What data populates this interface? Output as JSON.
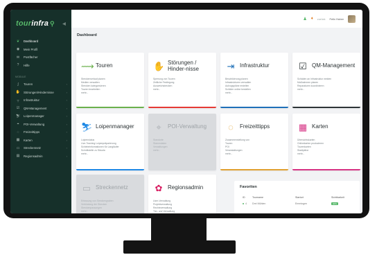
{
  "brand": {
    "part1": "tour",
    "part2": "infra",
    "pin_icon": "map-pin-icon"
  },
  "sidebar": {
    "items_top": [
      {
        "label": "Dashboard",
        "icon": "leaf-icon",
        "glyph": "❦",
        "active": true
      },
      {
        "label": "Mein Profil",
        "icon": "user-icon",
        "glyph": "◉",
        "active": false
      },
      {
        "label": "Postfächer",
        "icon": "mail-icon",
        "glyph": "✉",
        "active": false
      },
      {
        "label": "Hilfe",
        "icon": "help-icon",
        "glyph": "?",
        "active": false
      }
    ],
    "section_label": "MODULE",
    "items_modules": [
      {
        "label": "Touren",
        "icon": "route-icon",
        "glyph": "∫"
      },
      {
        "label": "Störungen/Hindernisse",
        "icon": "hand-icon",
        "glyph": "✋"
      },
      {
        "label": "Infrastruktur",
        "icon": "signpost-icon",
        "glyph": "┬"
      },
      {
        "label": "QM-Management",
        "icon": "checklist-icon",
        "glyph": "☑"
      },
      {
        "label": "Loipenmanager",
        "icon": "skier-icon",
        "glyph": "⛷"
      },
      {
        "label": "POI-Verwaltung",
        "icon": "poi-icon",
        "glyph": "⌖"
      },
      {
        "label": "Freizeittipps",
        "icon": "tips-icon",
        "glyph": "◌"
      },
      {
        "label": "Karten",
        "icon": "map-icon",
        "glyph": "▦"
      },
      {
        "label": "Streckennetz",
        "icon": "network-icon",
        "glyph": "▭"
      },
      {
        "label": "Regionsadmin",
        "icon": "admin-icon",
        "glyph": "▤"
      }
    ]
  },
  "topbar": {
    "link": "zurück",
    "user": "Felix Huber"
  },
  "page_title": "Dashboard",
  "cards": [
    {
      "title": "Touren",
      "icon": "route-icon",
      "glyph": "⟿",
      "color": "#6ab04c",
      "disabled": false,
      "lines": [
        "Streckenverlauf planen",
        "Medien verwalten",
        "Strecken kategorisieren",
        "Touren bearbeiten",
        "mehr..."
      ]
    },
    {
      "title": "Störungen / Hinder-nisse",
      "icon": "hand-stop-icon",
      "glyph": "✋",
      "color": "#e53935",
      "disabled": false,
      "lines": [
        "Sperrung von Touren",
        "Zeitliche Festlegung",
        "Ausweichstrecken",
        "mehr..."
      ]
    },
    {
      "title": "Infrastruktur",
      "icon": "signpost-icon",
      "glyph": "⇥",
      "color": "#1e6fb8",
      "disabled": false,
      "lines": [
        "Beschilderung planen",
        "Infrastrukturen verwalten",
        "Aufzugspläne erstellen",
        "Schilder online bestellen",
        "mehr..."
      ]
    },
    {
      "title": "QM-Management",
      "icon": "checklist-icon",
      "glyph": "☑",
      "color": "#2d3436",
      "disabled": false,
      "lines": [
        "Schäden an Infrastruktur melden",
        "Maßnahmen planen",
        "Reparaturen koordinieren",
        "mehr..."
      ]
    },
    {
      "title": "Loipenmanager",
      "icon": "skier-icon",
      "glyph": "⛷",
      "color": "#1e88e5",
      "disabled": false,
      "lines": [
        "Loipenstatus",
        "Live-Tracking Loipenpräparierung",
        "Schiebeinformationen für Langläufer",
        "Schnittstelle zu Skiuzla",
        "mehr..."
      ]
    },
    {
      "title": "POI-Verwaltung",
      "icon": "poi-icon",
      "glyph": "⌖",
      "color": "#b0b4b8",
      "disabled": true,
      "lines": [
        "Standorte",
        "Stammdaten",
        "Verwaltungen",
        "mehr..."
      ]
    },
    {
      "title": "Freizeittipps",
      "icon": "tips-icon",
      "glyph": "◌",
      "color": "#e0a030",
      "disabled": false,
      "lines": [
        "Zusammenstellung von",
        "Touren",
        "POI",
        "Veranstaltungen",
        "mehr..."
      ]
    },
    {
      "title": "Karten",
      "icon": "map-icon",
      "glyph": "▦",
      "color": "#d63384",
      "disabled": false,
      "lines": [
        "Übersichtskarten",
        "Onlinekarten produzieren",
        "Tourenkarten",
        "Stadtpläne",
        "mehr..."
      ]
    },
    {
      "title": "Streckennetz",
      "icon": "network-icon",
      "glyph": "▭",
      "color": "#b0b4b8",
      "disabled": true,
      "lines": [
        "Erfassung von Streckengraben",
        "Verbindung der Strecken",
        "Streckenpassungen",
        "mehr..."
      ]
    },
    {
      "title": "Regionsadmin",
      "icon": "admin-icon",
      "glyph": "✿",
      "color": "#d81b60",
      "disabled": false,
      "lines": [
        "User-Verwaltung",
        "Projektverwaltung",
        "Rechteverwaltung",
        "Tier- und Verwaltung",
        "mehr..."
      ]
    }
  ],
  "favorites": {
    "title": "Favoriten",
    "headers": [
      "ID",
      "Tourname",
      "Startort",
      "Sichtbarkeit"
    ],
    "row": {
      "id": "4",
      "name": "Drei Mühlen",
      "start": "Emmingen",
      "status": "aktiv"
    }
  }
}
